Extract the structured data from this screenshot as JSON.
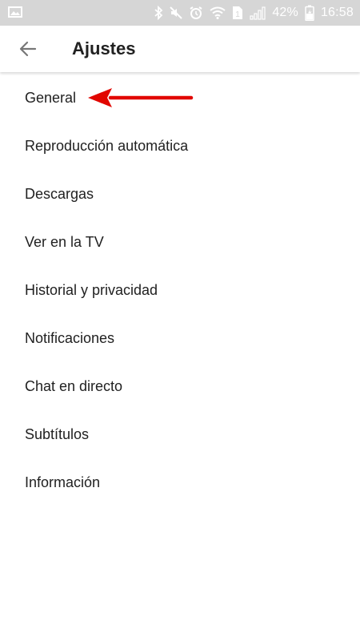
{
  "status_bar": {
    "battery_percent": "42%",
    "time": "16:58",
    "sim_badge": "1",
    "icons": [
      "image-icon",
      "bluetooth-icon",
      "mute-icon",
      "alarm-icon",
      "wifi-icon",
      "sim-icon",
      "signal-icon",
      "battery-charging-icon"
    ]
  },
  "app_bar": {
    "back_icon": "arrow-left-icon",
    "title": "Ajustes"
  },
  "settings": {
    "items": [
      {
        "label": "General"
      },
      {
        "label": "Reproducción automática"
      },
      {
        "label": "Descargas"
      },
      {
        "label": "Ver en la TV"
      },
      {
        "label": "Historial y privacidad"
      },
      {
        "label": "Notificaciones"
      },
      {
        "label": "Chat en directo"
      },
      {
        "label": "Subtítulos"
      },
      {
        "label": "Información"
      }
    ]
  },
  "annotation": {
    "icon": "red-arrow-left-icon",
    "points_to": "General",
    "color": "#e10600"
  },
  "colors": {
    "status_bar_bg": "#d6d6d6",
    "text_primary": "#212121",
    "back_arrow": "#777777"
  }
}
